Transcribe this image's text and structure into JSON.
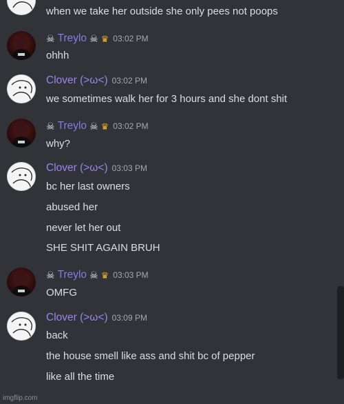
{
  "users": {
    "treylo": {
      "name": "Treylo"
    },
    "clover": {
      "name": "Clover (>ω<)"
    }
  },
  "messages": [
    {
      "text": "when we take her outside she only pees not poops"
    },
    {
      "author": "treylo",
      "time": "03:02 PM",
      "lines": [
        "ohhh"
      ]
    },
    {
      "author": "clover",
      "time": "03:02 PM",
      "lines": [
        "we sometimes walk her for 3 hours and she dont shit"
      ]
    },
    {
      "author": "treylo",
      "time": "03:02 PM",
      "lines": [
        "why?"
      ]
    },
    {
      "author": "clover",
      "time": "03:03 PM",
      "lines": [
        "bc her last owners",
        "abused her",
        "never let her out",
        "SHE SHIT AGAIN BRUH"
      ]
    },
    {
      "author": "treylo",
      "time": "03:03 PM",
      "lines": [
        "OMFG"
      ]
    },
    {
      "author": "clover",
      "time": "03:09 PM",
      "lines": [
        "back",
        "the house smell like ass and shit bc of pepper",
        "like all the time"
      ]
    }
  ],
  "watermark": "imgflip.com",
  "colors": {
    "background": "#313338",
    "treylo_name": "#8b78e6",
    "clover_name": "#9b84ee",
    "crown": "#f0b232",
    "timestamp": "#a4a8ae"
  },
  "icons": {
    "role_badge": "skull-crossbones-icon",
    "owner_badge": "crown-icon"
  }
}
